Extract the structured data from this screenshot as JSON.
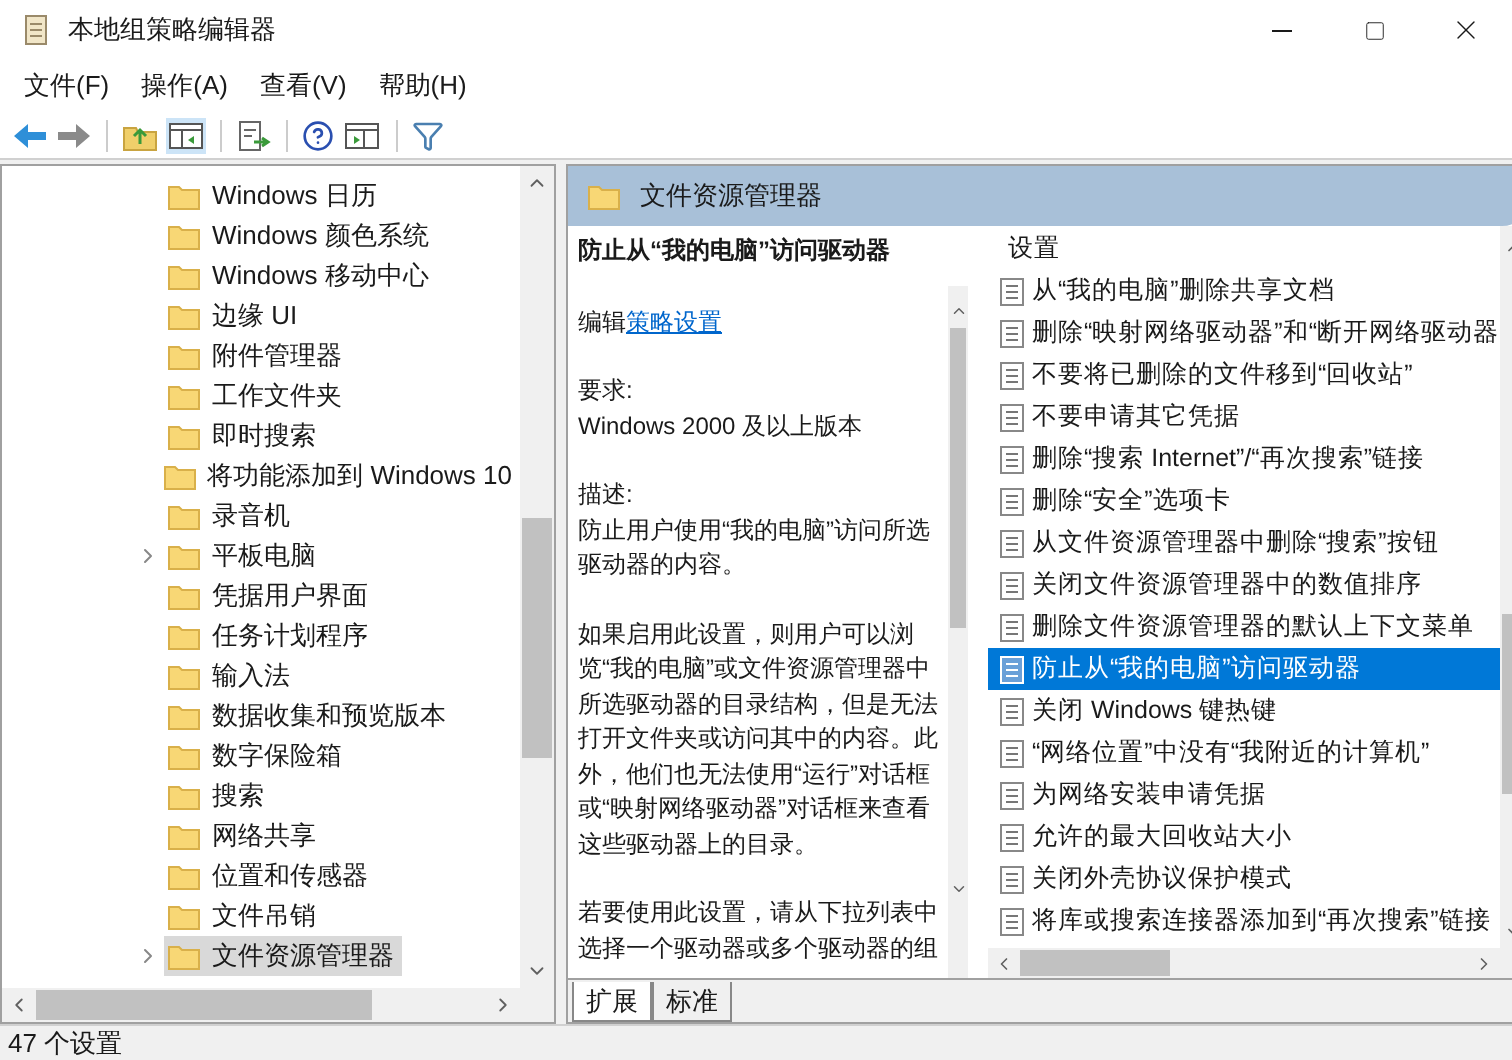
{
  "window": {
    "title": "本地组策略编辑器"
  },
  "menu": [
    "文件(F)",
    "操作(A)",
    "查看(V)",
    "帮助(H)"
  ],
  "tree": [
    {
      "label": "Windows 日历",
      "expandable": false,
      "selected": false
    },
    {
      "label": "Windows 颜色系统",
      "expandable": false,
      "selected": false
    },
    {
      "label": "Windows 移动中心",
      "expandable": false,
      "selected": false
    },
    {
      "label": "边缘 UI",
      "expandable": false,
      "selected": false
    },
    {
      "label": "附件管理器",
      "expandable": false,
      "selected": false
    },
    {
      "label": "工作文件夹",
      "expandable": false,
      "selected": false
    },
    {
      "label": "即时搜索",
      "expandable": false,
      "selected": false
    },
    {
      "label": "将功能添加到 Windows 10",
      "expandable": false,
      "selected": false
    },
    {
      "label": "录音机",
      "expandable": false,
      "selected": false
    },
    {
      "label": "平板电脑",
      "expandable": true,
      "selected": false
    },
    {
      "label": "凭据用户界面",
      "expandable": false,
      "selected": false
    },
    {
      "label": "任务计划程序",
      "expandable": false,
      "selected": false
    },
    {
      "label": "输入法",
      "expandable": false,
      "selected": false
    },
    {
      "label": "数据收集和预览版本",
      "expandable": false,
      "selected": false
    },
    {
      "label": "数字保险箱",
      "expandable": false,
      "selected": false
    },
    {
      "label": "搜索",
      "expandable": false,
      "selected": false
    },
    {
      "label": "网络共享",
      "expandable": false,
      "selected": false
    },
    {
      "label": "位置和传感器",
      "expandable": false,
      "selected": false
    },
    {
      "label": "文件吊销",
      "expandable": false,
      "selected": false
    },
    {
      "label": "文件资源管理器",
      "expandable": true,
      "selected": true
    }
  ],
  "pane_header": "文件资源管理器",
  "description": {
    "title": "防止从“我的电脑”访问驱动器",
    "edit_prefix": "编辑",
    "edit_link": "策略设置",
    "requirements_label": "要求:",
    "requirements": "Windows 2000 及以上版本",
    "description_label": "描述:",
    "paragraphs": [
      "防止用户使用“我的电脑”访问所选驱动器的内容。",
      "如果启用此设置，则用户可以浏览“我的电脑”或文件资源管理器中所选驱动器的目录结构，但是无法打开文件夹或访问其中的内容。此外，他们也无法使用“运行”对话框或“映射网络驱动器”对话框来查看这些驱动器上的目录。",
      "若要使用此设置，请从下拉列表中选择一个驱动器或多个驱动器的组"
    ]
  },
  "settings_header": "设置",
  "settings": [
    {
      "label": "从“我的电脑”删除共享文档",
      "selected": false
    },
    {
      "label": "删除“映射网络驱动器”和“断开网络驱动器",
      "selected": false
    },
    {
      "label": "不要将已删除的文件移到“回收站”",
      "selected": false
    },
    {
      "label": "不要申请其它凭据",
      "selected": false
    },
    {
      "label": "删除“搜索 Internet”/“再次搜索”链接",
      "selected": false
    },
    {
      "label": "删除“安全”选项卡",
      "selected": false
    },
    {
      "label": "从文件资源管理器中删除“搜索”按钮",
      "selected": false
    },
    {
      "label": "关闭文件资源管理器中的数值排序",
      "selected": false
    },
    {
      "label": "删除文件资源管理器的默认上下文菜单",
      "selected": false
    },
    {
      "label": "防止从“我的电脑”访问驱动器",
      "selected": true
    },
    {
      "label": "关闭 Windows 键热键",
      "selected": false
    },
    {
      "label": "“网络位置”中没有“我附近的计算机”",
      "selected": false
    },
    {
      "label": "为网络安装申请凭据",
      "selected": false
    },
    {
      "label": "允许的最大回收站大小",
      "selected": false
    },
    {
      "label": "关闭外壳协议保护模式",
      "selected": false
    },
    {
      "label": "将库或搜索连接器添加到“再次搜索”链接",
      "selected": false
    }
  ],
  "tabs": [
    {
      "label": "扩展",
      "selected": true
    },
    {
      "label": "标准",
      "selected": false
    }
  ],
  "status_bar": "47 个设置"
}
